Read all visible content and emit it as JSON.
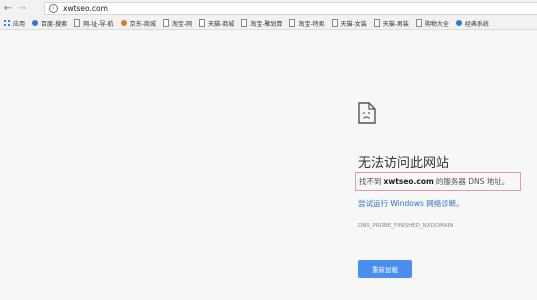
{
  "toolbar": {
    "back_icon": "arrow-left-icon",
    "forward_icon": "arrow-right-icon",
    "url": "xwtseo.com"
  },
  "bookmarks": [
    {
      "label": "应用",
      "icon": "apps-grid-icon"
    },
    {
      "label": "百度-搜索",
      "icon": "globe-icon"
    },
    {
      "label": "网-址-导-航",
      "icon": "page-icon"
    },
    {
      "label": "京东-商城",
      "icon": "globe-icon"
    },
    {
      "label": "淘宝-网",
      "icon": "page-icon"
    },
    {
      "label": "天猫-商城",
      "icon": "page-icon"
    },
    {
      "label": "淘宝-聚划算",
      "icon": "page-icon"
    },
    {
      "label": "淘宝-特卖",
      "icon": "page-icon"
    },
    {
      "label": "天猫-女装",
      "icon": "page-icon"
    },
    {
      "label": "天猫-男装",
      "icon": "page-icon"
    },
    {
      "label": "购物大全",
      "icon": "page-icon"
    },
    {
      "label": "经典系统",
      "icon": "globe-icon"
    }
  ],
  "error": {
    "title": "无法访问此网站",
    "box_prefix": "找不到",
    "box_domain": "xwtseo.com",
    "box_suffix": "的服务器 DNS 地址。",
    "diagnose": "尝试运行 Windows 网络诊断。",
    "code": "DNS_PROBE_FINISHED_NXDOMAIN",
    "reload_label": "重新加载",
    "icon": "sad-page-icon"
  },
  "colors": {
    "accent": "#4a8ff0",
    "link": "#2a6fc9",
    "highlight_border": "#d9a0a0"
  }
}
